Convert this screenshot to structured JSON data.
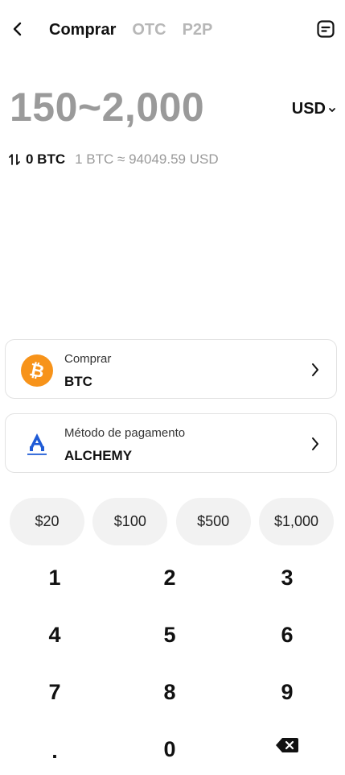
{
  "header": {
    "tabs": [
      {
        "label": "Comprar",
        "active": true
      },
      {
        "label": "OTC",
        "active": false
      },
      {
        "label": "P2P",
        "active": false
      }
    ],
    "back_icon": "back-arrow-icon",
    "orders_icon": "orders-icon"
  },
  "amount": {
    "range": "150~2,000",
    "currency": "USD",
    "currency_icon": "chevron-down-icon"
  },
  "conversion": {
    "btc_amount": "0 BTC",
    "rate": "1 BTC ≈ 94049.59 USD",
    "swap_icon": "swap-icon"
  },
  "buy_card": {
    "label": "Comprar",
    "value": "BTC",
    "icon": "bitcoin-icon",
    "accent": "#f7931a"
  },
  "payment_card": {
    "label": "Método de pagamento",
    "value": "ALCHEMY",
    "icon": "alchemy-pay-logo",
    "accent": "#1f5bd6"
  },
  "quick_amounts": [
    "$20",
    "$100",
    "$500",
    "$1,000"
  ],
  "keypad": {
    "keys": [
      "1",
      "2",
      "3",
      "4",
      "5",
      "6",
      "7",
      "8",
      "9",
      ".",
      "0"
    ],
    "backspace_icon": "backspace-icon"
  }
}
